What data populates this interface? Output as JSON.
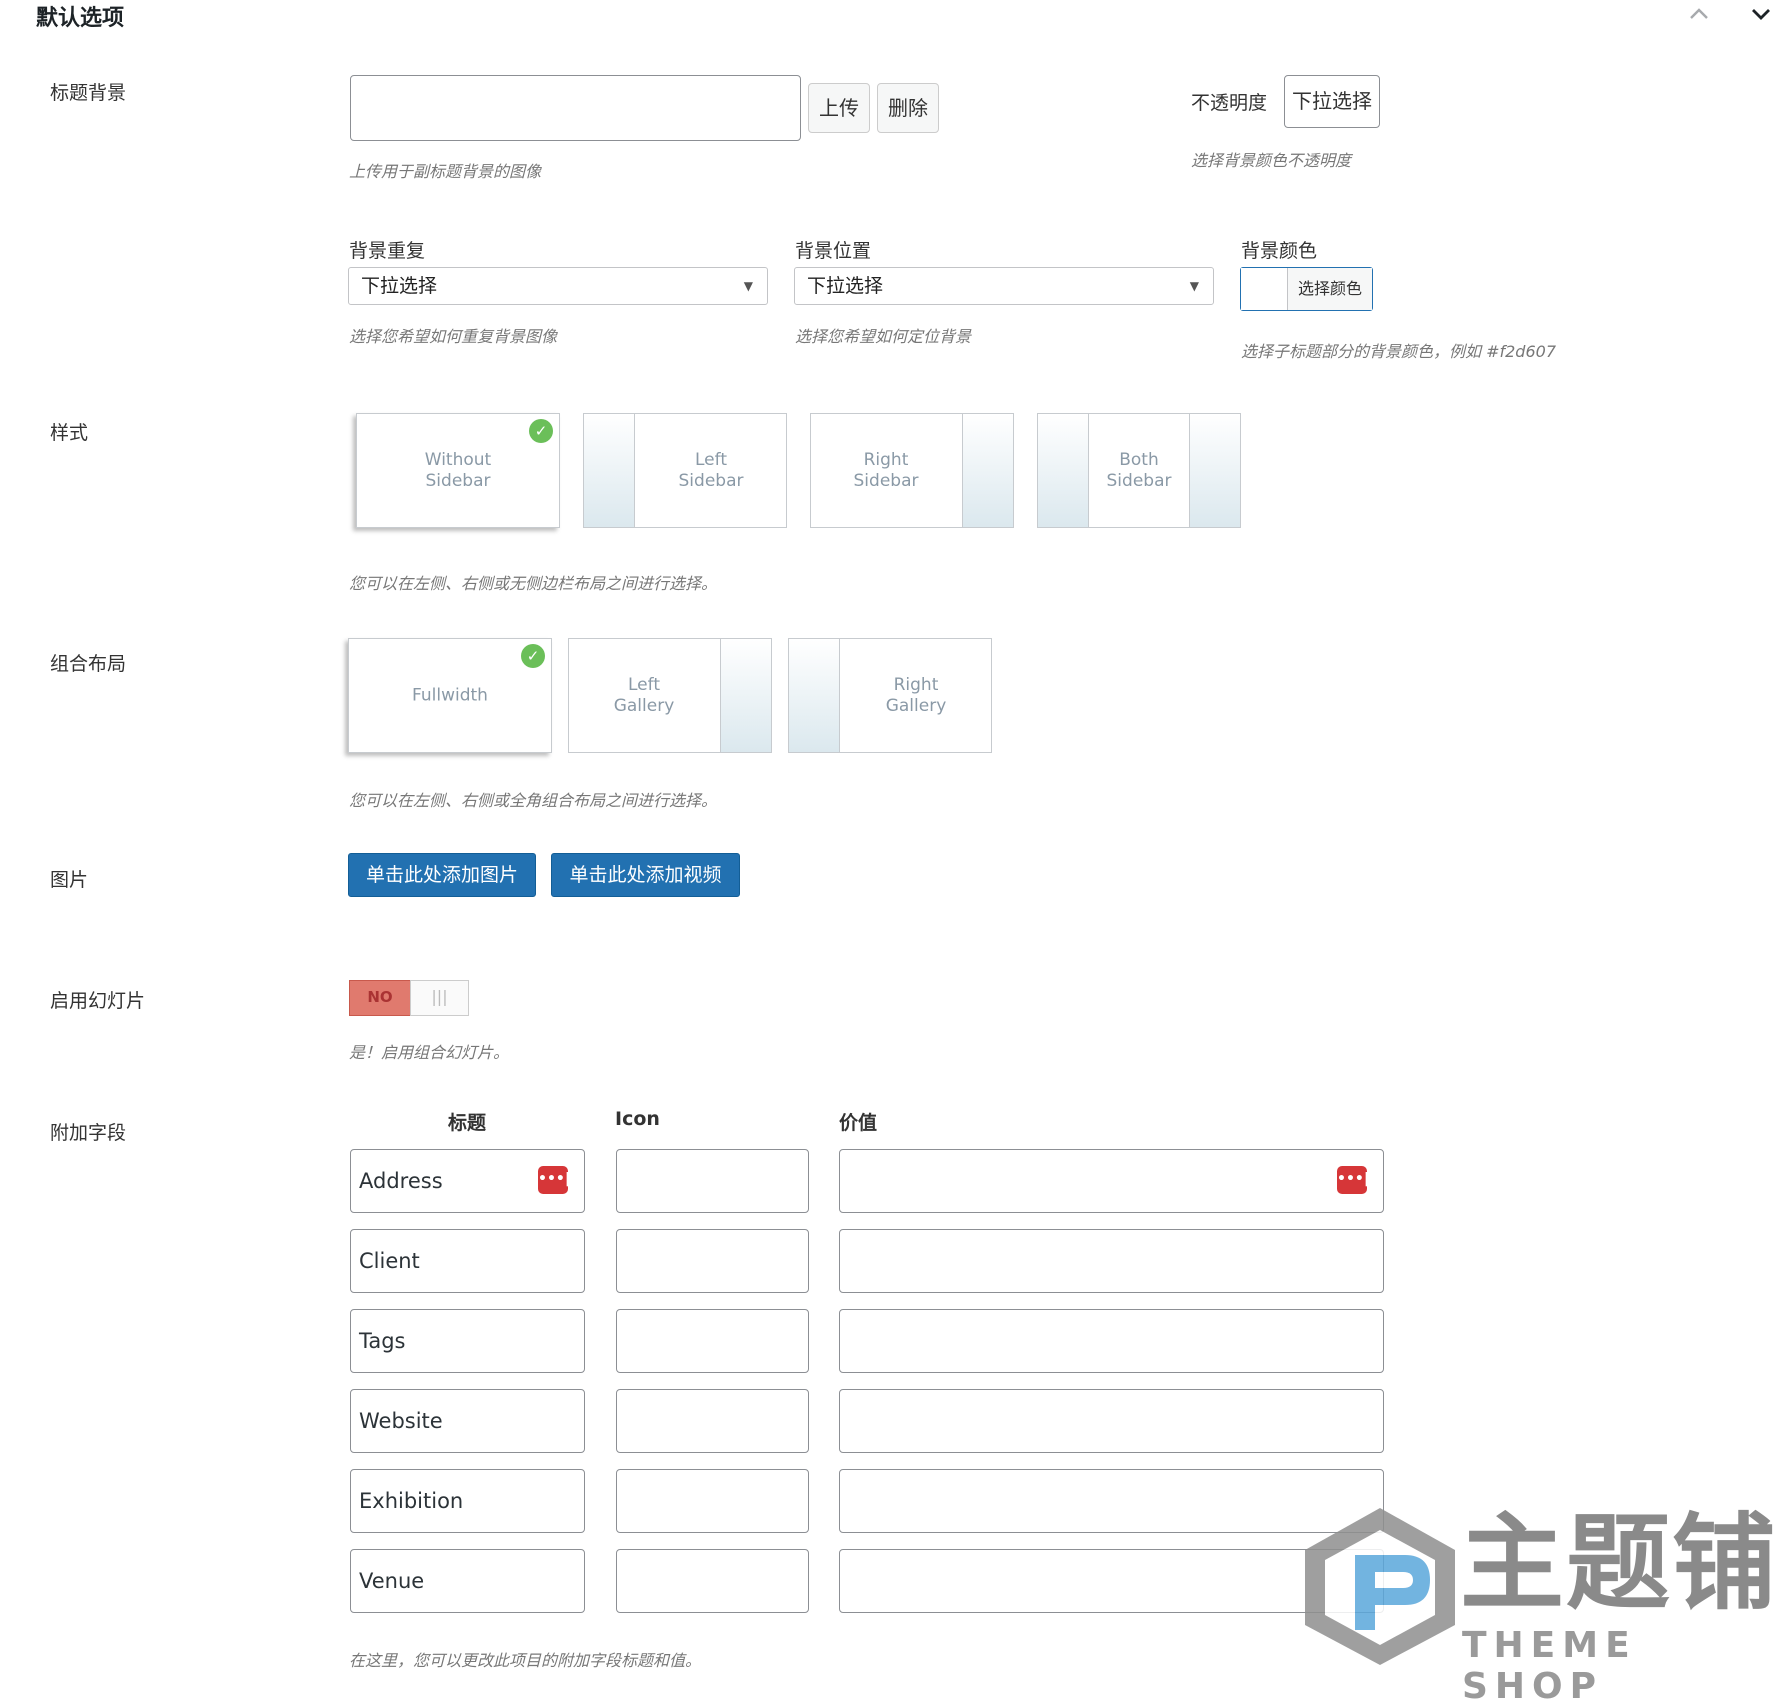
{
  "header": {
    "title": "默认选项",
    "collapse_icon": "chevron-up-icon",
    "toggle_icon": "chevron-down-icon"
  },
  "title_bg": {
    "label": "标题背景",
    "upload": "上传",
    "delete": "删除",
    "hint": "上传用于副标题背景的图像",
    "opacity_label": "不透明度",
    "opacity_value": "下拉选择",
    "opacity_hint": "选择背景颜色不透明度"
  },
  "bg_repeat": {
    "label": "背景重复",
    "value": "下拉选择",
    "hint": "选择您希望如何重复背景图像"
  },
  "bg_position": {
    "label": "背景位置",
    "value": "下拉选择",
    "hint": "选择您希望如何定位背景"
  },
  "bg_color": {
    "label": "背景颜色",
    "button": "选择颜色",
    "hint": "选择子标题部分的背景颜色，例如 #f2d607"
  },
  "style": {
    "label": "样式",
    "options": [
      {
        "text": "Without\nSidebar",
        "selected": true
      },
      {
        "text": "Left\nSidebar",
        "selected": false
      },
      {
        "text": "Right\nSidebar",
        "selected": false
      },
      {
        "text": "Both\nSidebar",
        "selected": false
      }
    ],
    "hint": "您可以在左侧、右侧或无侧边栏布局之间进行选择。"
  },
  "layout": {
    "label": "组合布局",
    "options": [
      {
        "text": "Fullwidth",
        "selected": true
      },
      {
        "text": "Left\nGallery",
        "selected": false
      },
      {
        "text": "Right\nGallery",
        "selected": false
      }
    ],
    "hint": "您可以在左侧、右侧或全角组合布局之间进行选择。"
  },
  "images": {
    "label": "图片",
    "add_image": "单击此处添加图片",
    "add_video": "单击此处添加视频"
  },
  "slideshow": {
    "label": "启用幻灯片",
    "toggle_state": "NO",
    "handle": "|||",
    "hint": "是！启用组合幻灯片。"
  },
  "extra_fields": {
    "label": "附加字段",
    "headers": {
      "title": "标题",
      "icon": "Icon",
      "value": "价值"
    },
    "rows": [
      {
        "title": "Address",
        "icon": "",
        "value": ""
      },
      {
        "title": "Client",
        "icon": "",
        "value": ""
      },
      {
        "title": "Tags",
        "icon": "",
        "value": ""
      },
      {
        "title": "Website",
        "icon": "",
        "value": ""
      },
      {
        "title": "Exhibition",
        "icon": "",
        "value": ""
      },
      {
        "title": "Venue",
        "icon": "",
        "value": ""
      }
    ],
    "dots": "•••|",
    "hint": "在这里，您可以更改此项目的附加字段标题和值。"
  },
  "watermark": {
    "cn": "主题铺",
    "en": "THEME SHOP"
  },
  "colors": {
    "primary": "#2271b1",
    "check": "#6bbf59",
    "danger": "#d63638",
    "toggle_off": "#e07a6e"
  }
}
